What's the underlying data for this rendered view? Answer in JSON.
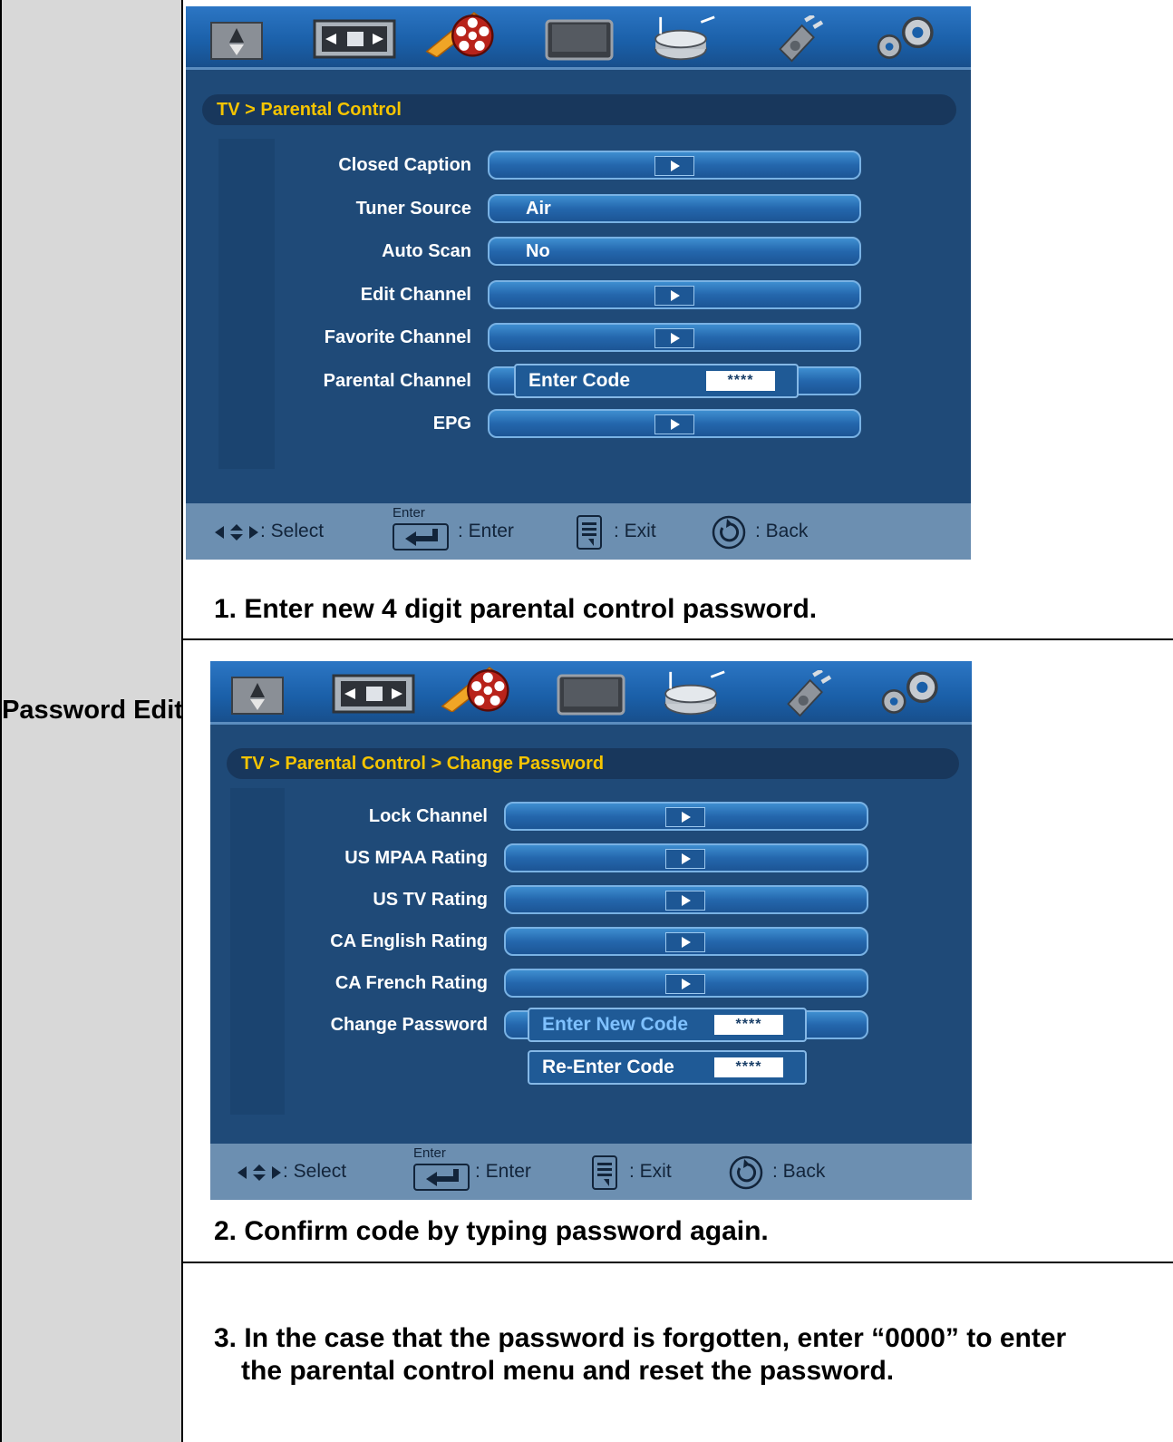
{
  "section_label": "Password Edit",
  "screen1": {
    "breadcrumb": "TV > Parental Control",
    "rows": [
      {
        "label": "Closed Caption",
        "value": "",
        "arrow": true
      },
      {
        "label": "Tuner Source",
        "value": "Air",
        "arrow": false
      },
      {
        "label": "Auto Scan",
        "value": "No",
        "arrow": false
      },
      {
        "label": "Edit Channel",
        "value": "",
        "arrow": true
      },
      {
        "label": "Favorite Channel",
        "value": "",
        "arrow": true
      },
      {
        "label": "Parental Channel",
        "value": "",
        "arrow": false
      },
      {
        "label": "EPG",
        "value": "",
        "arrow": true
      }
    ],
    "code_prompt": "Enter Code",
    "code_mask": "****"
  },
  "screen2": {
    "breadcrumb": "TV > Parental Control > Change Password",
    "rows": [
      {
        "label": "Lock Channel",
        "arrow": true
      },
      {
        "label": "US MPAA Rating",
        "arrow": true
      },
      {
        "label": "US TV Rating",
        "arrow": true
      },
      {
        "label": "CA English Rating",
        "arrow": true
      },
      {
        "label": "CA French Rating",
        "arrow": true
      },
      {
        "label": "Change Password",
        "arrow": false
      }
    ],
    "new_code_prompt": "Enter New Code",
    "reenter_prompt": "Re-Enter Code",
    "code_mask": "****"
  },
  "footer": {
    "select": ": Select",
    "enter_key": "Enter",
    "enter": ": Enter",
    "exit": ": Exit",
    "back": ": Back"
  },
  "steps": {
    "step1": "1. Enter new 4 digit parental control password.",
    "step2": "2. Confirm code by typing password again.",
    "step3_line1": "3. In the case that the password is forgotten, enter “0000” to enter",
    "step3_line2": "the parental control menu and reset the password."
  },
  "colors": {
    "osd_bg": "#1f4a78",
    "breadcrumb_text": "#f5c400",
    "footer_bg": "#6c8fb1",
    "left_column_bg": "#d8d8d8"
  },
  "icons": [
    "picture-icon",
    "screen-size-icon",
    "film-reel-icon",
    "monitor-icon",
    "music-drum-icon",
    "plug-icon",
    "gear-icon"
  ]
}
